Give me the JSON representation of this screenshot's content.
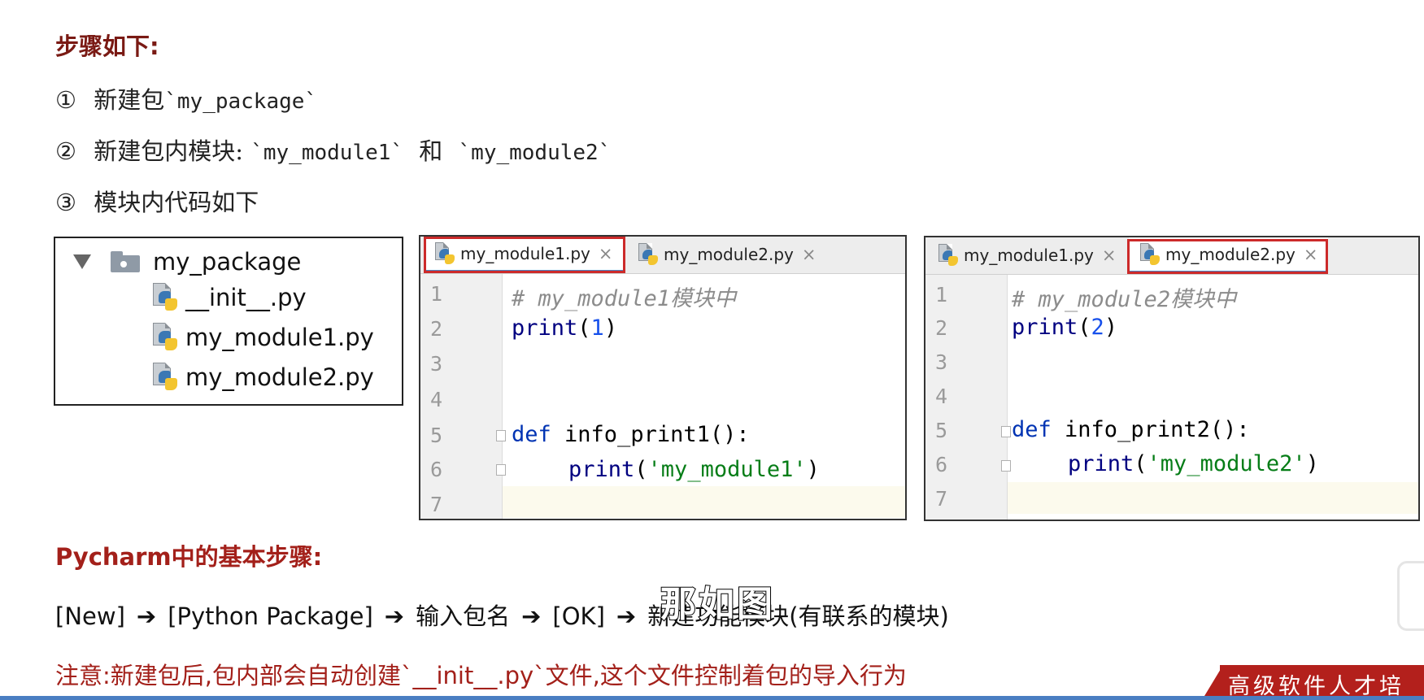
{
  "heading": "步骤如下:",
  "steps": [
    {
      "num": "①",
      "text": "新建包",
      "mono": "`my_package`",
      "rest": ""
    },
    {
      "num": "②",
      "text": "新建包内模块:",
      "mono": "`my_module1`",
      "mid": "和",
      "mono2": "`my_module2`"
    },
    {
      "num": "③",
      "text": "模块内代码如下"
    }
  ],
  "tree": {
    "folder": "my_package",
    "files": [
      "__init__.py",
      "my_module1.py",
      "my_module2.py"
    ]
  },
  "editor1": {
    "tabs": [
      "my_module1.py",
      "my_module2.py"
    ],
    "active_tab": 0,
    "line_numbers": [
      "1",
      "2",
      "3",
      "4",
      "5",
      "6",
      "7"
    ],
    "code": {
      "comment": "# my_module1模块中",
      "print_fn": "print",
      "print_open": "(",
      "print_arg": "1",
      "print_close": ")",
      "def_kw": "def",
      "def_rest": " info_print1():",
      "inner_print": "print",
      "inner_open": "(",
      "inner_str": "'my_module1'",
      "inner_close": ")"
    }
  },
  "editor2": {
    "tabs": [
      "my_module1.py",
      "my_module2.py"
    ],
    "active_tab": 1,
    "line_numbers": [
      "1",
      "2",
      "3",
      "4",
      "5",
      "6",
      "7"
    ],
    "code": {
      "comment": "# my_module2模块中",
      "print_fn": "print",
      "print_open": "(",
      "print_arg": "2",
      "print_close": ")",
      "def_kw": "def",
      "def_rest": " info_print2():",
      "inner_print": "print",
      "inner_open": "(",
      "inner_str": "'my_module2'",
      "inner_close": ")"
    }
  },
  "pycharm_heading": "Pycharm中的基本步骤:",
  "flow": {
    "items": [
      "[New]",
      "[Python Package]",
      "输入包名",
      "[OK]",
      "新建功能模块(有联系的模块)"
    ],
    "arrow": "➔"
  },
  "note": "注意:新建包后,包内部会自动创建`__init__.py`文件,这个文件控制着包的导入行为",
  "subtitle": "那如图",
  "banner": "高级软件人才培",
  "colors": {
    "heading": "#7a1a14",
    "accent_red": "#a3201a",
    "tab_active_underline": "#4a88c7",
    "keyword": "#0033b3",
    "string": "#067d17"
  }
}
